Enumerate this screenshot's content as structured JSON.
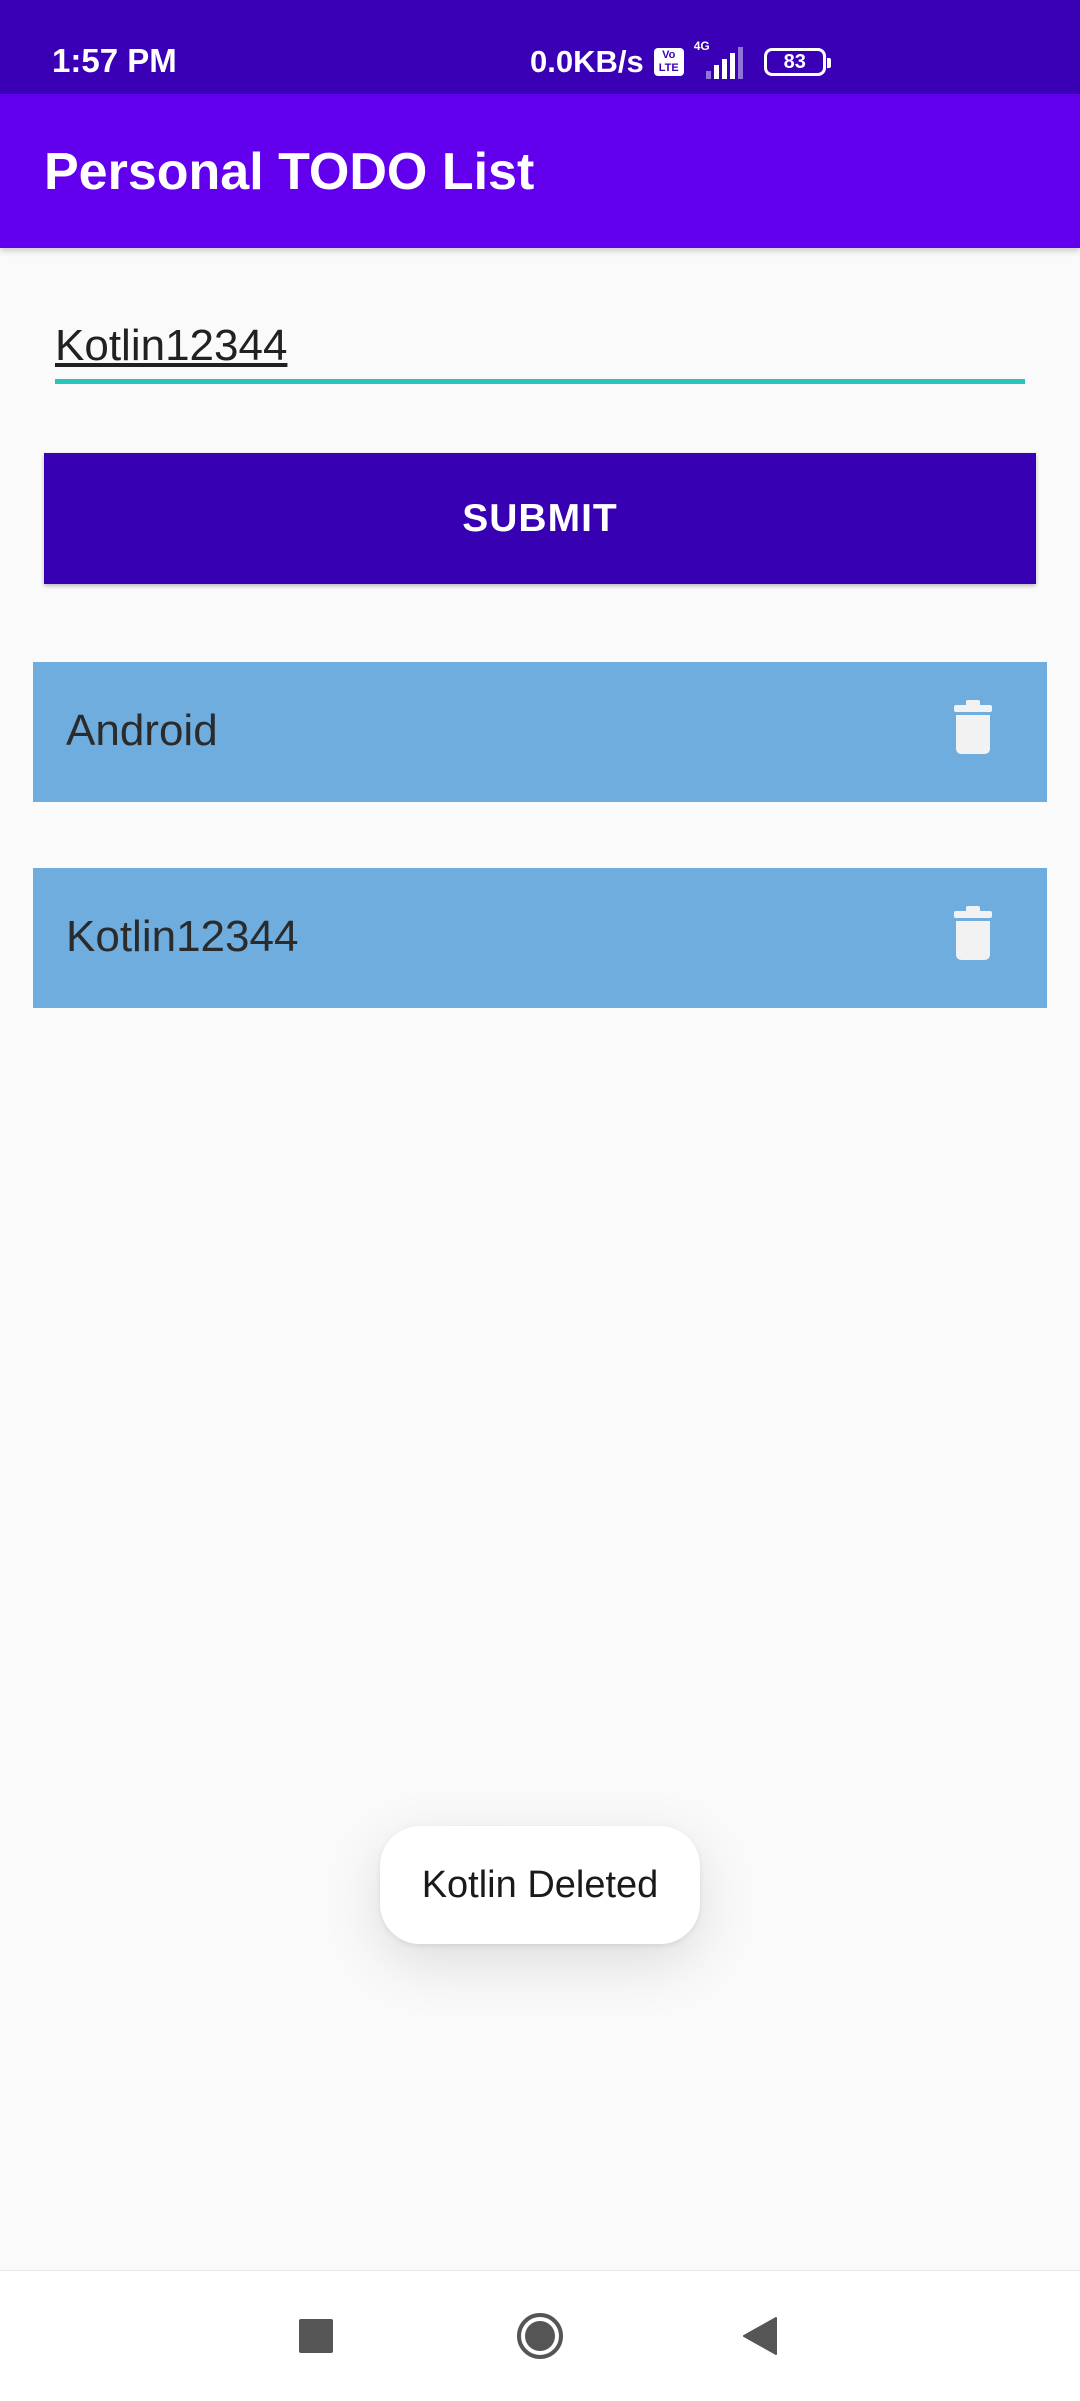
{
  "status_bar": {
    "time": "1:57 PM",
    "net_speed": "0.0KB/s",
    "volte_label": "Vo LTE",
    "signal_label": "4G",
    "battery_level": "83"
  },
  "app_bar": {
    "title": "Personal TODO List"
  },
  "input": {
    "value": "Kotlin12344",
    "accent_color": "#26c6b8"
  },
  "submit": {
    "label": "SUBMIT"
  },
  "todos": [
    {
      "label": "Android",
      "icon": "trash-icon"
    },
    {
      "label": "Kotlin12344",
      "icon": "trash-icon"
    }
  ],
  "toast": {
    "message": "Kotlin Deleted"
  },
  "nav": {
    "recents_icon": "square-recents-icon",
    "home_icon": "circle-home-icon",
    "back_icon": "triangle-back-icon"
  },
  "colors": {
    "status_bar": "#3a00b6",
    "app_bar": "#6200ee",
    "submit_button": "#3700b3",
    "todo_item": "#6fadde",
    "background": "#fafafa"
  }
}
